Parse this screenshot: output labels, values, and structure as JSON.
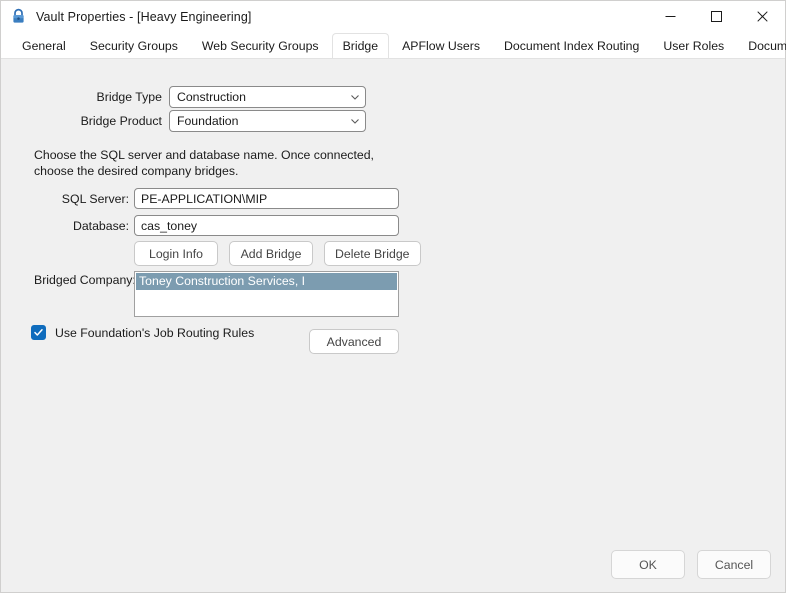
{
  "window": {
    "title": "Vault Properties - [Heavy Engineering]",
    "icon": "lock-icon",
    "controls": {
      "minimize": "minimize-icon",
      "maximize": "maximize-icon",
      "close": "close-icon"
    }
  },
  "tabs": [
    {
      "label": "General",
      "active": false
    },
    {
      "label": "Security Groups",
      "active": false
    },
    {
      "label": "Web Security Groups",
      "active": false
    },
    {
      "label": "Bridge",
      "active": true
    },
    {
      "label": "APFlow Users",
      "active": false
    },
    {
      "label": "Document Index Routing",
      "active": false
    },
    {
      "label": "User Roles",
      "active": false
    },
    {
      "label": "Document Publishing",
      "active": false
    }
  ],
  "form": {
    "bridge_type": {
      "label": "Bridge Type",
      "value": "Construction",
      "chevron": "chevron-down-icon"
    },
    "bridge_product": {
      "label": "Bridge Product",
      "value": "Foundation",
      "chevron": "chevron-down-icon"
    },
    "help_text": "Choose the SQL server and database name.  Once connected, choose the desired company bridges.",
    "sql_server": {
      "label": "SQL Server:",
      "value": "PE-APPLICATION\\MIP",
      "placeholder": ""
    },
    "database": {
      "label": "Database:",
      "value": "cas_toney",
      "placeholder": ""
    },
    "buttons": {
      "login_info": "Login Info",
      "add_bridge": "Add Bridge",
      "delete_bridge": "Delete Bridge",
      "advanced": "Advanced"
    },
    "bridged_company": {
      "label": "Bridged Company:",
      "items": [
        {
          "text": "Toney Construction Services, I",
          "selected": true
        }
      ]
    },
    "routing_checkbox": {
      "label": "Use Foundation's Job Routing Rules",
      "checked": true,
      "check_icon": "checkmark-icon"
    }
  },
  "footer": {
    "ok": "OK",
    "cancel": "Cancel"
  },
  "colors": {
    "accent": "#0f6cbd",
    "selection": "#7c9cb0",
    "content_bg": "#f0f0f0",
    "titlebar_bg": "#ffffff"
  }
}
